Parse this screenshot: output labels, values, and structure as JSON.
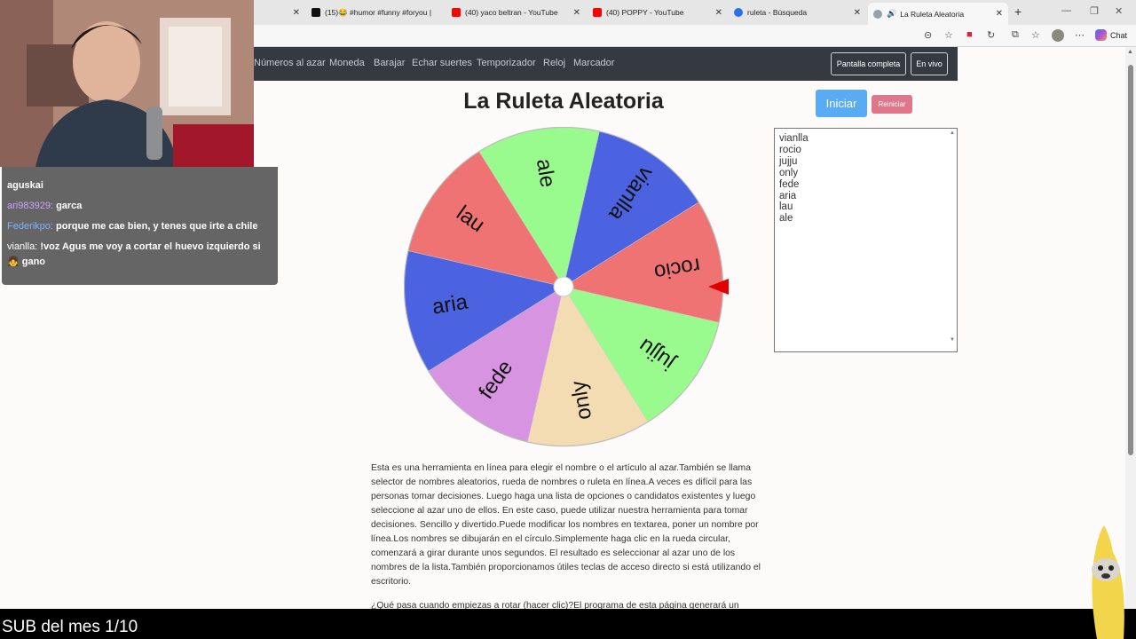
{
  "browser": {
    "tabs": [
      {
        "title": "",
        "color": "#ff0050"
      },
      {
        "title": "(15)😂 #humor #funny #foryou | ",
        "color": "#111111"
      },
      {
        "title": "(40) yaco beltran - YouTube",
        "color": "#ff0000"
      },
      {
        "title": "(40) POPPY - YouTube",
        "color": "#ff0000"
      },
      {
        "title": "ruleta - Búsqueda",
        "color": "#2a6ee8"
      },
      {
        "title": "La Ruleta Aleatoria",
        "color": "#9aa0a6"
      }
    ],
    "chat_label": "Chat"
  },
  "nav": {
    "links": [
      "Números al azar",
      "Moneda",
      "Barajar",
      "Echar suertes",
      "Temporizador",
      "Reloj",
      "Marcador"
    ],
    "fullscreen": "Pantalla completa",
    "live": "En vivo"
  },
  "page": {
    "title": "La Ruleta Aleatoria",
    "start_button": "Iniciar",
    "reset_button": "Reiniciar",
    "names": [
      "vianlla",
      "rocio",
      "jujju",
      "only",
      "fede",
      "aria",
      "lau",
      "ale"
    ],
    "description": "Esta es una herramienta en línea para elegir el nombre o el artículo al azar.También se llama selector de nombres aleatorios, rueda de nombres o ruleta en línea.A veces es difícil para las personas tomar decisiones. Luego haga una lista de opciones o candidatos existentes y luego seleccione al azar uno de ellos. En este caso, puede utilizar nuestra herramienta para tomar decisiones. Sencillo y divertido.Puede modificar los nombres en textarea, poner un nombre por línea.Los nombres se dibujarán en el círculo.Simplemente haga clic en la rueda circular, comenzará a girar durante unos segundos. El resultado es seleccionar al azar uno de los nombres de la lista.También proporcionamos útiles teclas de acceso directo si está utilizando el escritorio.",
    "description2": "¿Qué pasa cuando empiezas a rotar (hacer clic)?El programa de esta página generará un"
  },
  "wheel": {
    "segments": [
      {
        "label": "ale",
        "color": "#99fa8e"
      },
      {
        "label": "lau",
        "color": "#f07373"
      },
      {
        "label": "aria",
        "color": "#4b63e0"
      },
      {
        "label": "fede",
        "color": "#d794e0"
      },
      {
        "label": "only",
        "color": "#f3dcb2"
      },
      {
        "label": "jujju",
        "color": "#99fa8e"
      },
      {
        "label": "rocio",
        "color": "#f07373"
      },
      {
        "label": "vianlla",
        "color": "#4b63e0"
      }
    ],
    "pointer_color": "#e00000"
  },
  "stream": {
    "chat": [
      {
        "user": "ari983929:",
        "user_color": "#c9a2ff",
        "text": "garca"
      },
      {
        "user": "Federikpo:",
        "user_color": "#7fb2ff",
        "text": "porque me cae bien, y tenes que irte a chile"
      },
      {
        "user": "vianlla:",
        "user_color": "#ffffff",
        "text": "!voz Agus me voy a cortar el huevo izquierdo si 👧 gano"
      }
    ],
    "chat_cut_top": "aguskai",
    "sub_text": "SUB del mes 1/10"
  }
}
